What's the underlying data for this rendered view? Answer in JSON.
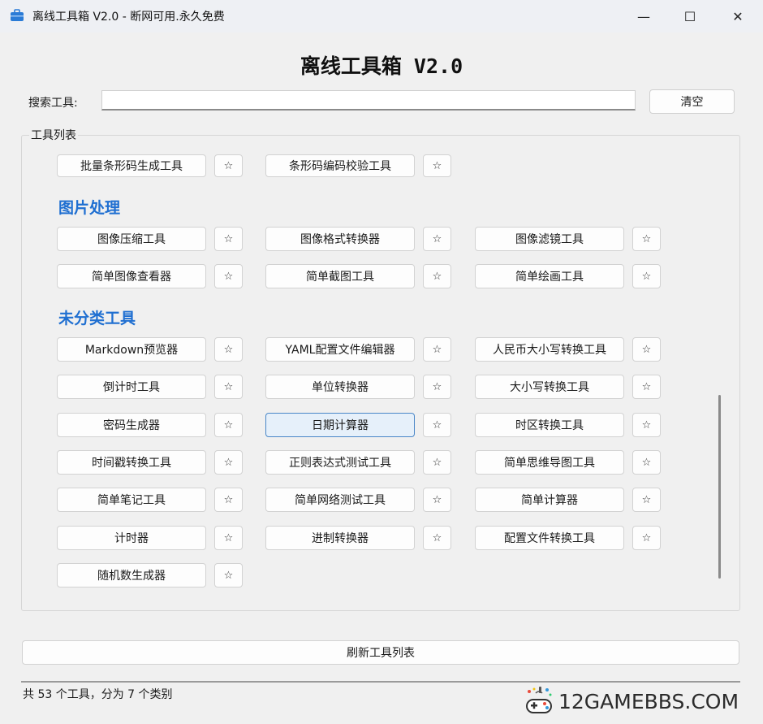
{
  "window": {
    "title": "离线工具箱 V2.0 - 断网可用.永久免费",
    "minimize": "—",
    "maximize": "☐",
    "close": "✕"
  },
  "header": {
    "heading": "离线工具箱 V2.0",
    "search_label": "搜索工具:",
    "search_value": "",
    "clear_label": "清空"
  },
  "tool_list": {
    "group_label": "工具列表",
    "star_glyph": "☆",
    "partial_row": [
      "批量条形码生成工具",
      "条形码编码校验工具"
    ],
    "categories": [
      {
        "name": "图片处理",
        "tools": [
          "图像压缩工具",
          "图像格式转换器",
          "图像滤镜工具",
          "简单图像查看器",
          "简单截图工具",
          "简单绘画工具"
        ]
      },
      {
        "name": "未分类工具",
        "tools": [
          "Markdown预览器",
          "YAML配置文件编辑器",
          "人民币大小写转换工具",
          "倒计时工具",
          "单位转换器",
          "大小写转换工具",
          "密码生成器",
          "日期计算器",
          "时区转换工具",
          "时间戳转换工具",
          "正则表达式测试工具",
          "简单思维导图工具",
          "简单笔记工具",
          "简单网络测试工具",
          "简单计算器",
          "计时器",
          "进制转换器",
          "配置文件转换工具",
          "随机数生成器"
        ]
      }
    ]
  },
  "footer": {
    "refresh_label": "刷新工具列表",
    "status": "共 53 个工具，分为 7 个类别",
    "watermark": "12GAMEBBS.COM"
  },
  "colors": {
    "category": "#1f6fd1",
    "selected_border": "#4a87c8",
    "selected_bg": "#e6f0fa"
  }
}
